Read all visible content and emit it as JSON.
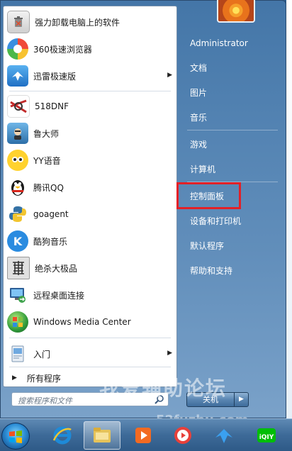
{
  "start_menu": {
    "programs": [
      {
        "label": "强力卸载电脑上的软件",
        "icon": "uninstaller-icon",
        "color": "#e8e8e8"
      },
      {
        "label": "360极速浏览器",
        "icon": "360-browser-icon",
        "color": "#f2a33a"
      },
      {
        "label": "迅雷极速版",
        "icon": "thunder-icon",
        "color": "#2b86d8",
        "has_arrow": true,
        "arrow": "▶"
      },
      {
        "label": "518DNF",
        "icon": "dnf-icon",
        "color": "#c22b2b"
      },
      {
        "label": "鲁大师",
        "icon": "ludashi-icon",
        "color": "#3a8fd0"
      },
      {
        "label": "YY语音",
        "icon": "yy-icon",
        "color": "#f5b800"
      },
      {
        "label": "腾讯QQ",
        "icon": "qq-penguin-icon",
        "color": "#222222"
      },
      {
        "label": "goagent",
        "icon": "python-icon",
        "color": "#3572a5"
      },
      {
        "label": "酷狗音乐",
        "icon": "kugou-icon",
        "color": "#2a8be0"
      },
      {
        "label": "绝杀大极品",
        "icon": "dragon-char-icon",
        "color": "#555555"
      },
      {
        "label": "远程桌面连接",
        "icon": "remote-desktop-icon",
        "color": "#3d7fc4"
      },
      {
        "label": "Windows Media Center",
        "icon": "media-center-icon",
        "color": "#2f9a3a"
      },
      {
        "label": "入门",
        "icon": "getting-started-icon",
        "color": "#5aa0d8",
        "has_arrow": true,
        "arrow": "▶"
      }
    ],
    "all_programs": {
      "label": "所有程序",
      "arrow": "▶"
    },
    "search": {
      "placeholder": "搜索程序和文件"
    },
    "right_items": [
      "Administrator",
      "文档",
      "图片",
      "音乐",
      "游戏",
      "计算机",
      "控制面板",
      "设备和打印机",
      "默认程序",
      "帮助和支持"
    ],
    "shutdown": {
      "label": "关机",
      "arrow": "▶"
    }
  },
  "watermark": {
    "line1": "我爱辅助论坛",
    "line2": "52fuzhu.com"
  },
  "taskbar": {
    "items": [
      "start-orb",
      "ie-icon",
      "explorer-icon",
      "media-player-icon",
      "video-icon",
      "thunder-icon",
      "iqiyi-icon"
    ]
  },
  "colors": {
    "highlight": "#e32027",
    "menu_blue": "#4678aa"
  }
}
